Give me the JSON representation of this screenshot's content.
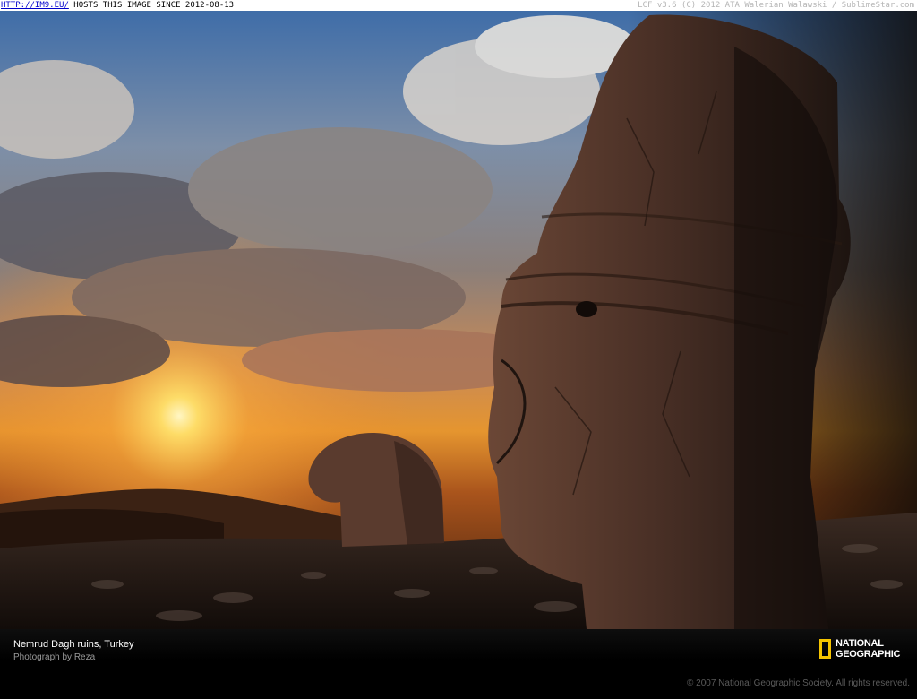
{
  "header": {
    "link_text": "HTTP://IM9.EU/",
    "hosts_text": " HOSTS THIS IMAGE SINCE 2012-08-13",
    "right_text": "LCF v3.6 (C) 2012 ATA Walerian Walawski / SublimeStar.com"
  },
  "caption": {
    "title": "Nemrud Dagh ruins, Turkey",
    "credit": "Photograph by Reza",
    "copyright": "© 2007 National Geographic Society. All rights reserved."
  },
  "logo": {
    "line1": "NATIONAL",
    "line2": "GEOGRAPHIC",
    "frame_color": "#f5c400"
  },
  "photo": {
    "subject": "sunset-with-stone-head-statue",
    "sky_top": "#4f7bb5",
    "sun_color": "#fff3b0"
  }
}
